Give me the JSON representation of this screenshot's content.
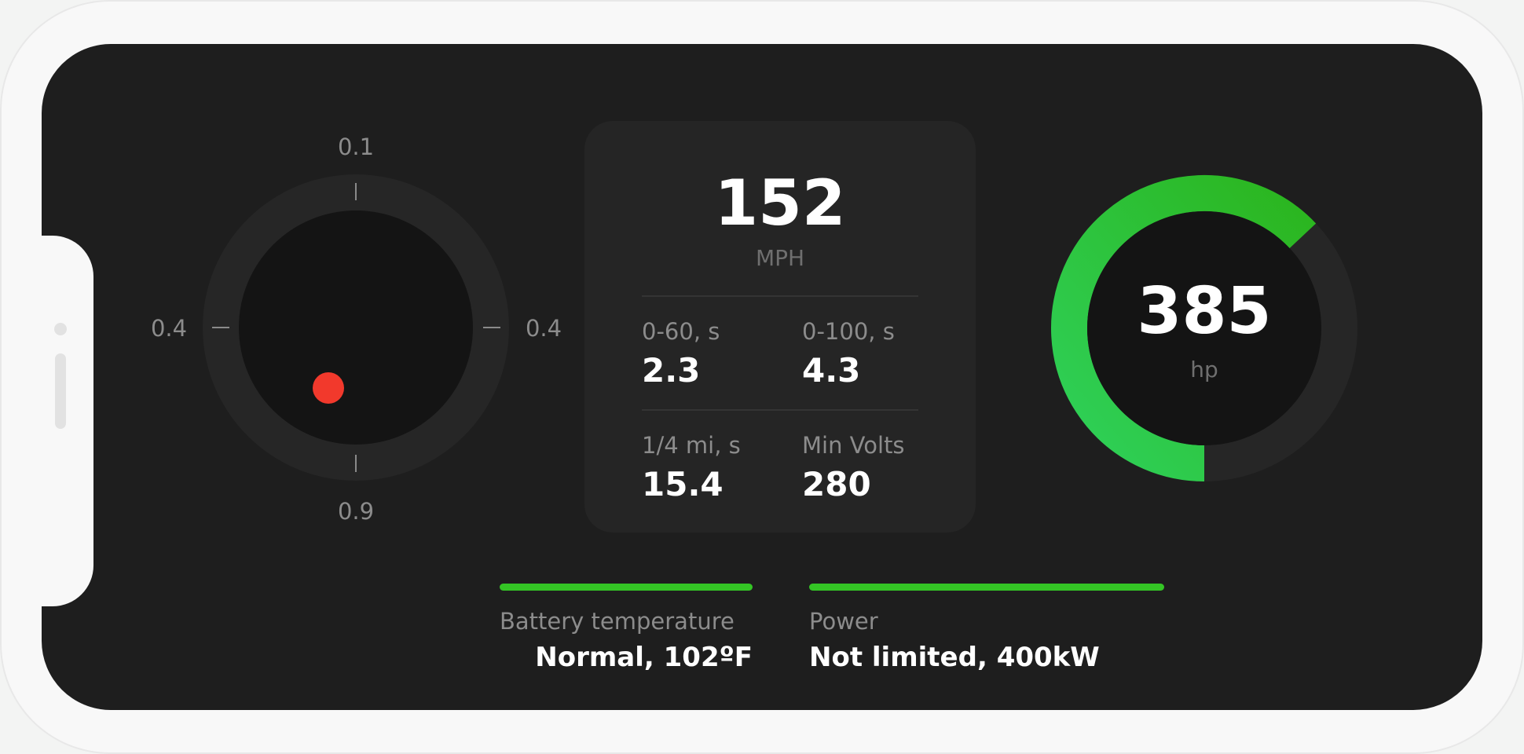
{
  "gyro": {
    "top_label": "0.1",
    "bottom_label": "0.9",
    "left_label": "0.4",
    "right_label": "0.4",
    "marker_color": "#f2392c"
  },
  "speed": {
    "value": "152",
    "unit": "MPH"
  },
  "stats": [
    {
      "label": "0-60, s",
      "value": "2.3"
    },
    {
      "label": "0-100, s",
      "value": "4.3"
    },
    {
      "label": "1/4 mi, s",
      "value": "15.4"
    },
    {
      "label": "Min Volts",
      "value": "280"
    }
  ],
  "power_gauge": {
    "value": "385",
    "unit": "hp",
    "fill_fraction": 0.63,
    "gradient_start": "#2fd15a",
    "gradient_end": "#2bb51e",
    "track_color": "#262626"
  },
  "status": {
    "battery": {
      "label": "Battery temperature",
      "value": "Normal, 102ºF"
    },
    "power": {
      "label": "Power",
      "value": "Not limited, 400kW"
    },
    "bar_color": "#34c525"
  }
}
